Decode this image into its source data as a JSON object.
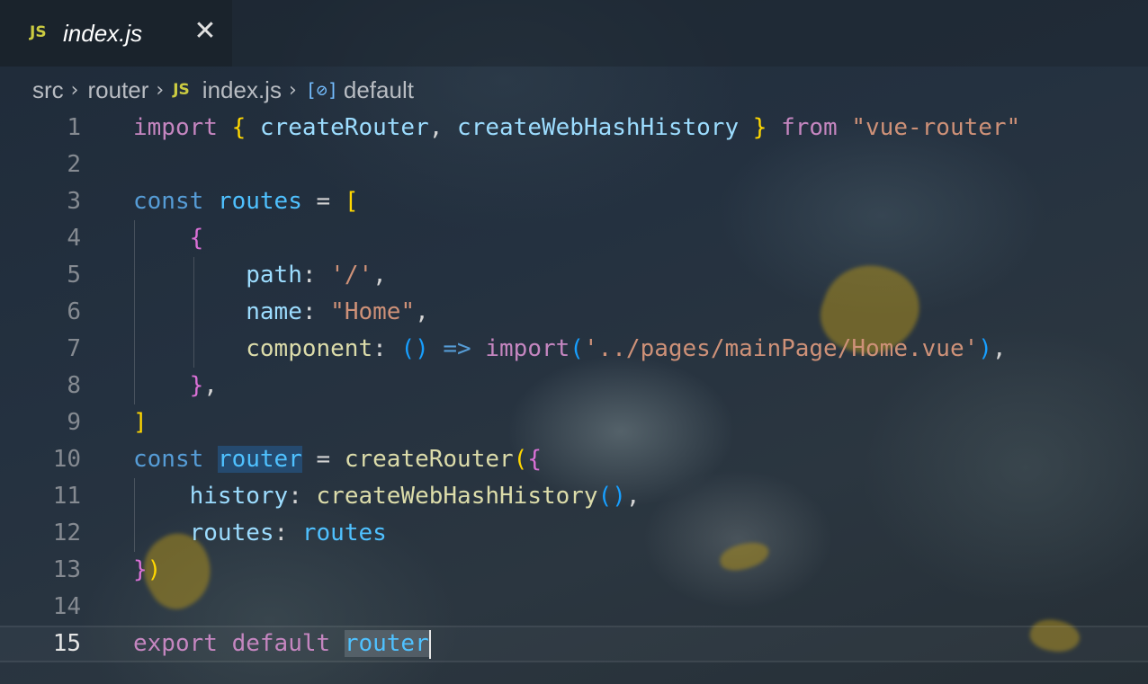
{
  "tab": {
    "icon": "JS",
    "label": "index.js",
    "close_glyph": "✕"
  },
  "breadcrumb": {
    "items": [
      "src",
      "router",
      "index.js",
      "default"
    ],
    "file_icon": "JS",
    "symbol_icon": "[⊘]"
  },
  "editor": {
    "line_numbers": [
      "1",
      "2",
      "3",
      "4",
      "5",
      "6",
      "7",
      "8",
      "9",
      "10",
      "11",
      "12",
      "13",
      "14",
      "15"
    ],
    "current_line": 15,
    "lines": [
      {
        "segments": [
          [
            "kw",
            "import"
          ],
          [
            "punc",
            " "
          ],
          [
            "b1",
            "{"
          ],
          [
            "punc",
            " "
          ],
          [
            "prop",
            "createRouter"
          ],
          [
            "punc",
            ", "
          ],
          [
            "prop",
            "createWebHashHistory"
          ],
          [
            "punc",
            " "
          ],
          [
            "b1",
            "}"
          ],
          [
            "punc",
            " "
          ],
          [
            "kw",
            "from"
          ],
          [
            "punc",
            " "
          ],
          [
            "str",
            "\"vue-router\""
          ]
        ]
      },
      {
        "segments": []
      },
      {
        "segments": [
          [
            "kw2",
            "const"
          ],
          [
            "punc",
            " "
          ],
          [
            "var",
            "routes"
          ],
          [
            "punc",
            " = "
          ],
          [
            "b1",
            "["
          ]
        ]
      },
      {
        "segments": [
          [
            "punc",
            "    "
          ],
          [
            "b2",
            "{"
          ]
        ]
      },
      {
        "segments": [
          [
            "punc",
            "        "
          ],
          [
            "prop",
            "path"
          ],
          [
            "punc",
            ": "
          ],
          [
            "str",
            "'/'"
          ],
          [
            "punc",
            ","
          ]
        ]
      },
      {
        "segments": [
          [
            "punc",
            "        "
          ],
          [
            "prop",
            "name"
          ],
          [
            "punc",
            ": "
          ],
          [
            "str",
            "\"Home\""
          ],
          [
            "punc",
            ","
          ]
        ]
      },
      {
        "segments": [
          [
            "punc",
            "        "
          ],
          [
            "fn",
            "component"
          ],
          [
            "punc",
            ": "
          ],
          [
            "b3",
            "()"
          ],
          [
            "punc",
            " "
          ],
          [
            "kw2",
            "=>"
          ],
          [
            "punc",
            " "
          ],
          [
            "kw",
            "import"
          ],
          [
            "b3",
            "("
          ],
          [
            "str",
            "'../pages/mainPage/Home.vue'"
          ],
          [
            "b3",
            ")"
          ],
          [
            "punc",
            ","
          ]
        ]
      },
      {
        "segments": [
          [
            "punc",
            "    "
          ],
          [
            "b2",
            "}"
          ],
          [
            "punc",
            ","
          ]
        ]
      },
      {
        "segments": [
          [
            "b1",
            "]"
          ]
        ]
      },
      {
        "segments": [
          [
            "kw2",
            "const"
          ],
          [
            "punc",
            " "
          ],
          [
            "var hl-sel",
            "router"
          ],
          [
            "punc",
            " = "
          ],
          [
            "fn",
            "createRouter"
          ],
          [
            "b1",
            "("
          ],
          [
            "b2",
            "{"
          ]
        ]
      },
      {
        "segments": [
          [
            "punc",
            "    "
          ],
          [
            "prop",
            "history"
          ],
          [
            "punc",
            ": "
          ],
          [
            "fn",
            "createWebHashHistory"
          ],
          [
            "b3",
            "()"
          ],
          [
            "punc",
            ","
          ]
        ]
      },
      {
        "segments": [
          [
            "punc",
            "    "
          ],
          [
            "prop",
            "routes"
          ],
          [
            "punc",
            ": "
          ],
          [
            "var",
            "routes"
          ]
        ]
      },
      {
        "segments": [
          [
            "b2",
            "}"
          ],
          [
            "b1",
            ")"
          ]
        ]
      },
      {
        "segments": []
      },
      {
        "segments": [
          [
            "kw",
            "export"
          ],
          [
            "punc",
            " "
          ],
          [
            "kw",
            "default"
          ],
          [
            "punc",
            " "
          ],
          [
            "var hl-word",
            "router"
          ]
        ]
      }
    ]
  },
  "colors": {
    "keyword": "#c586c0",
    "storage": "#569cd6",
    "variable": "#4fc1ff",
    "property": "#9cdcfe",
    "string": "#ce9178",
    "function": "#dcdcaa",
    "bracket_1": "#ffd700",
    "bracket_2": "#da70d6",
    "bracket_3": "#179fff",
    "js_icon": "#cbcb41"
  }
}
